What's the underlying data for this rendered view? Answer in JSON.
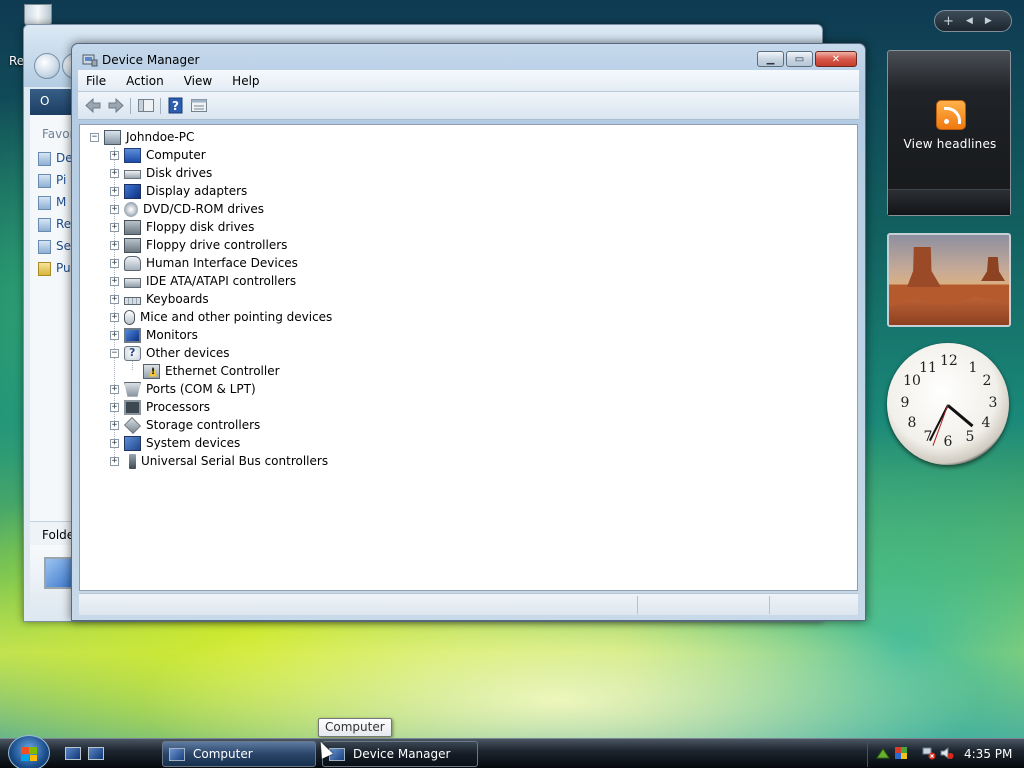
{
  "desktop": {
    "recycle_label": "Re"
  },
  "background_window": {
    "cmd_label": "O",
    "favorites_label": "Favor",
    "links": [
      "De",
      "Pi",
      "M",
      "Re",
      "Se",
      "Pu"
    ],
    "folders_label": "Folde"
  },
  "device_manager": {
    "title": "Device Manager",
    "menu": [
      "File",
      "Action",
      "View",
      "Help"
    ],
    "root": "Johndoe-PC",
    "categories": [
      {
        "label": "Computer",
        "icon": "computer-icon",
        "expanded": false
      },
      {
        "label": "Disk drives",
        "icon": "disk-drive-icon",
        "expanded": false
      },
      {
        "label": "Display adapters",
        "icon": "display-adapter-icon",
        "expanded": false
      },
      {
        "label": "DVD/CD-ROM drives",
        "icon": "dvd-drive-icon",
        "expanded": false
      },
      {
        "label": "Floppy disk drives",
        "icon": "floppy-disk-icon",
        "expanded": false
      },
      {
        "label": "Floppy drive controllers",
        "icon": "floppy-controller-icon",
        "expanded": false
      },
      {
        "label": "Human Interface Devices",
        "icon": "hid-icon",
        "expanded": false
      },
      {
        "label": "IDE ATA/ATAPI controllers",
        "icon": "ide-controller-icon",
        "expanded": false
      },
      {
        "label": "Keyboards",
        "icon": "keyboard-icon",
        "expanded": false
      },
      {
        "label": "Mice and other pointing devices",
        "icon": "mouse-icon",
        "expanded": false
      },
      {
        "label": "Monitors",
        "icon": "monitor-icon",
        "expanded": false
      },
      {
        "label": "Other devices",
        "icon": "other-devices-icon",
        "expanded": true
      },
      {
        "label": "Ports (COM & LPT)",
        "icon": "port-icon",
        "expanded": false
      },
      {
        "label": "Processors",
        "icon": "processor-icon",
        "expanded": false
      },
      {
        "label": "Storage controllers",
        "icon": "storage-controller-icon",
        "expanded": false
      },
      {
        "label": "System devices",
        "icon": "system-devices-icon",
        "expanded": false
      },
      {
        "label": "Universal Serial Bus controllers",
        "icon": "usb-icon",
        "expanded": false
      }
    ],
    "other_devices_children": [
      {
        "label": "Ethernet Controller",
        "icon": "warning-device-icon"
      }
    ]
  },
  "gadgets": {
    "feed_label": "View headlines",
    "clock_numbers": [
      "12",
      "1",
      "2",
      "3",
      "4",
      "5",
      "6",
      "7",
      "8",
      "9",
      "10",
      "11"
    ]
  },
  "taskbar": {
    "tasks": [
      {
        "label": "Computer",
        "active": true
      },
      {
        "label": "Device Manager",
        "active": false
      }
    ],
    "tooltip": "Computer",
    "time": "4:35 PM"
  }
}
